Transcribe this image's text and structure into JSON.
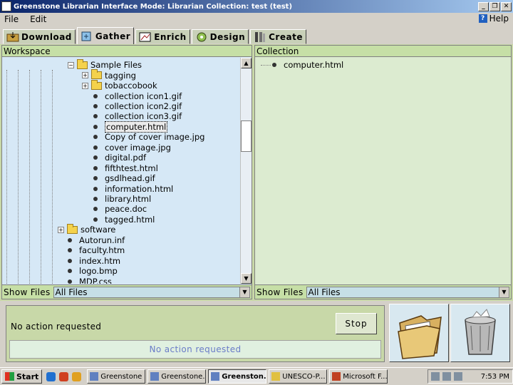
{
  "window": {
    "title": "Greenstone Librarian Interface  Mode: Librarian  Collection: test (test)",
    "controls": [
      "_",
      "❐",
      "✕"
    ]
  },
  "menu": {
    "file": "File",
    "edit": "Edit",
    "help": "Help"
  },
  "tabs": [
    {
      "label": "Download",
      "icon": "download-icon"
    },
    {
      "label": "Gather",
      "icon": "gather-icon",
      "active": true
    },
    {
      "label": "Enrich",
      "icon": "enrich-icon"
    },
    {
      "label": "Design",
      "icon": "design-icon"
    },
    {
      "label": "Create",
      "icon": "create-icon"
    }
  ],
  "workspace": {
    "header": "Workspace",
    "items": [
      {
        "label": "Sample Files",
        "type": "folder",
        "expanded": true
      },
      {
        "label": "tagging",
        "type": "folder"
      },
      {
        "label": "tobaccobook",
        "type": "folder"
      },
      {
        "label": "collection icon1.gif",
        "type": "file"
      },
      {
        "label": "collection icon2.gif",
        "type": "file"
      },
      {
        "label": "collection icon3.gif",
        "type": "file"
      },
      {
        "label": "computer.html",
        "type": "file",
        "selected": true
      },
      {
        "label": "Copy of cover image.jpg",
        "type": "file"
      },
      {
        "label": "cover image.jpg",
        "type": "file"
      },
      {
        "label": "digital.pdf",
        "type": "file"
      },
      {
        "label": "fifthtest.html",
        "type": "file"
      },
      {
        "label": "gsdlhead.gif",
        "type": "file"
      },
      {
        "label": "information.html",
        "type": "file"
      },
      {
        "label": "library.html",
        "type": "file"
      },
      {
        "label": "peace.doc",
        "type": "file"
      },
      {
        "label": "tagged.html",
        "type": "file"
      },
      {
        "label": "software",
        "type": "folder"
      },
      {
        "label": "Autorun.inf",
        "type": "file"
      },
      {
        "label": "faculty.htm",
        "type": "file"
      },
      {
        "label": "index.htm",
        "type": "file"
      },
      {
        "label": "logo.bmp",
        "type": "file"
      },
      {
        "label": "MDP.css",
        "type": "file"
      }
    ],
    "filter_label": "Show Files",
    "filter_value": "All Files"
  },
  "collection": {
    "header": "Collection",
    "items": [
      {
        "label": "computer.html"
      }
    ],
    "filter_label": "Show Files",
    "filter_value": "All Files"
  },
  "status": {
    "message": "No action requested",
    "stop_label": "Stop",
    "progress_text": "No action requested"
  },
  "taskbar": {
    "start": "Start",
    "tasks": [
      {
        "label": "Greenstone ..."
      },
      {
        "label": "Greenstone..."
      },
      {
        "label": "Greenston...",
        "active": true
      },
      {
        "label": "UNESCO-P..."
      },
      {
        "label": "Microsoft F..."
      }
    ],
    "clock": "7:53 PM"
  },
  "colors": {
    "title_bar": "#0a246a",
    "pane_header": "#c6dfa6",
    "workspace_bg": "#d6e8f6",
    "collection_bg": "#dcebd0"
  }
}
